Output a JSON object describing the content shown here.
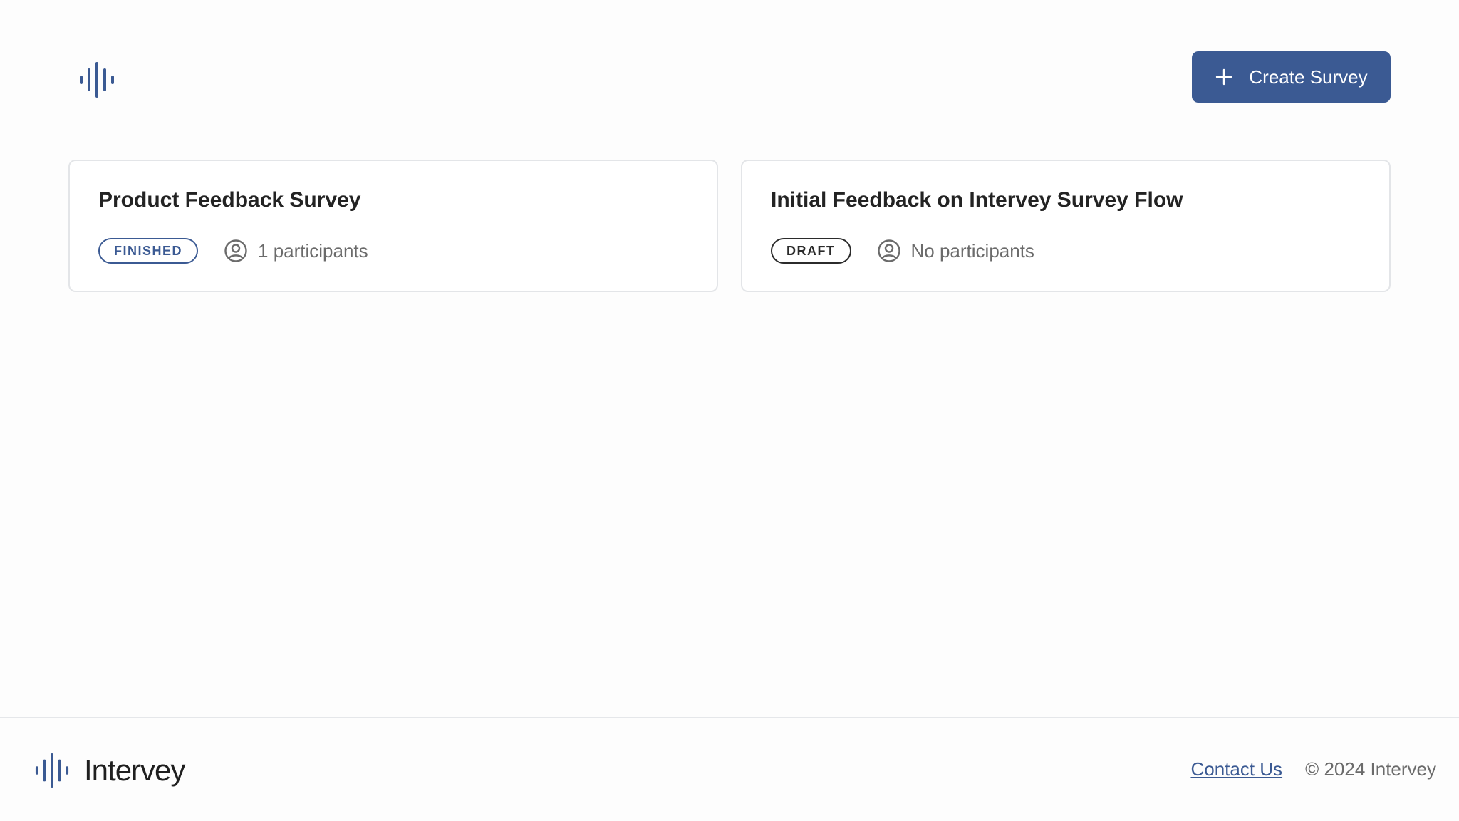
{
  "header": {
    "logo_icon": "waveform-icon",
    "create_button_label": "Create Survey",
    "create_button_icon": "plus-icon"
  },
  "colors": {
    "primary": "#3b5a93",
    "text": "#232323",
    "muted": "#6b6b6b",
    "border": "#e3e5e8"
  },
  "surveys": [
    {
      "title": "Product Feedback Survey",
      "status": "FINISHED",
      "participants": "1 participants"
    },
    {
      "title": "Initial Feedback on Intervey Survey Flow",
      "status": "DRAFT",
      "participants": "No participants"
    }
  ],
  "footer": {
    "brand_name": "Intervey",
    "contact_label": "Contact Us",
    "copyright": "© 2024 Intervey"
  }
}
